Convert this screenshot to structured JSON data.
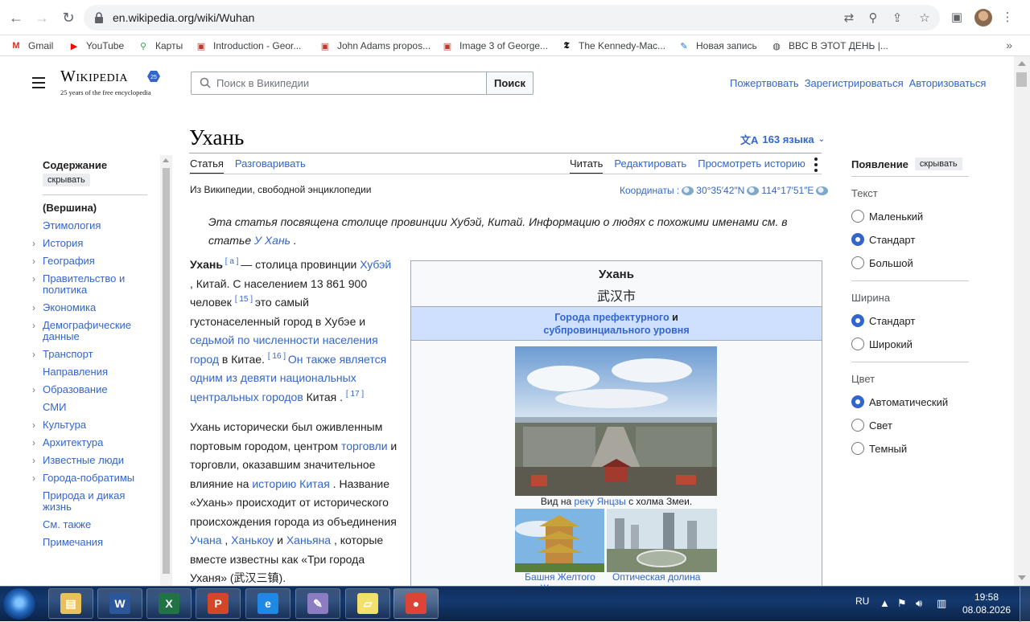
{
  "browser": {
    "url": "en.wikipedia.org/wiki/Wuhan",
    "bookmarks": [
      {
        "label": "Gmail",
        "icon": "gmail-icon",
        "color": "#d93025"
      },
      {
        "label": "YouTube",
        "icon": "youtube-icon",
        "color": "#ff0000"
      },
      {
        "label": "Карты",
        "icon": "maps-pin-icon",
        "color": "#34a853"
      },
      {
        "label": "Introduction - Geor...",
        "icon": "loc-icon",
        "color": "#c0392b"
      },
      {
        "label": "John Adams propos...",
        "icon": "loc-icon",
        "color": "#c0392b"
      },
      {
        "label": "Image 3 of George...",
        "icon": "loc-icon",
        "color": "#c0392b"
      },
      {
        "label": "The Kennedy-Mac...",
        "icon": "nyt-icon",
        "color": "#000000"
      },
      {
        "label": "Новая запись",
        "icon": "blog-icon",
        "color": "#1a73e8"
      },
      {
        "label": "BBC В ЭТОТ ДЕНЬ |...",
        "icon": "globe-icon",
        "color": "#3c4043"
      }
    ],
    "more": "»"
  },
  "wiki": {
    "logo_title": "Wikipedia",
    "logo_sub": "25 years of the free encyclopedia",
    "search_placeholder": "Поиск в Википедии",
    "search_button": "Поиск",
    "user_links": [
      "Пожертвовать",
      "Зарегистрироваться",
      "Авторизоваться"
    ],
    "title": "Ухань",
    "languages": "163 языка",
    "tabs_left": [
      "Статья",
      "Разговаривать"
    ],
    "tabs_right": [
      "Читать",
      "Редактировать",
      "Просмотреть историю"
    ],
    "from_wiki": "Из Википедии, свободной энциклопедии",
    "coords_label": "Координаты :",
    "coords_lat": "30°35′42″N",
    "coords_lon": "114°17′51″E",
    "hatnote_text": "Эта статья посвящена столице провинции Хубэй, Китай. Информацию о людях с похожими именами см. в статье",
    "hatnote_link": "У Хань",
    "hatnote_end": "."
  },
  "toc": {
    "heading": "Содержание",
    "hide": "скрывать",
    "items": [
      {
        "label": "(Вершина)",
        "bold": true,
        "chevron": false
      },
      {
        "label": "Этимология",
        "chevron": false
      },
      {
        "label": "История",
        "chevron": true
      },
      {
        "label": "География",
        "chevron": true
      },
      {
        "label": "Правительство и политика",
        "chevron": true
      },
      {
        "label": "Экономика",
        "chevron": true
      },
      {
        "label": "Демографические данные",
        "chevron": true
      },
      {
        "label": "Транспорт",
        "chevron": true
      },
      {
        "label": "Направления",
        "chevron": false
      },
      {
        "label": "Образование",
        "chevron": true
      },
      {
        "label": "СМИ",
        "chevron": false
      },
      {
        "label": "Культура",
        "chevron": true
      },
      {
        "label": "Архитектура",
        "chevron": true
      },
      {
        "label": "Известные люди",
        "chevron": true
      },
      {
        "label": "Города-побратимы",
        "chevron": true
      },
      {
        "label": "Природа и дикая жизнь",
        "chevron": false
      },
      {
        "label": "См. также",
        "chevron": false
      },
      {
        "label": "Примечания",
        "chevron": false
      }
    ]
  },
  "article": {
    "p1": [
      {
        "t": "b",
        "v": "Ухань"
      },
      {
        "t": "sup",
        "v": " [ а ] "
      },
      {
        "t": "s",
        "v": " — столица провинции "
      },
      {
        "t": "a",
        "v": "Хубэй"
      },
      {
        "t": "s",
        "v": " , Китай. С населением 13 861 900 человек "
      },
      {
        "t": "sup",
        "v": " [ 15 ] "
      },
      {
        "t": "s",
        "v": " это самый густонаселенный город в Хубэе и "
      },
      {
        "t": "a",
        "v": "седьмой по численности населения город"
      },
      {
        "t": "s",
        "v": " в Китае. "
      },
      {
        "t": "sup",
        "v": " [ 16 ] "
      },
      {
        "t": "a",
        "v": " Он также является одним из девяти национальных центральных городов"
      },
      {
        "t": "s",
        "v": " Китая . "
      },
      {
        "t": "sup",
        "v": " [ 17 ] "
      }
    ],
    "p2": [
      {
        "t": "s",
        "v": "Ухань исторически был оживленным портовым городом, центром "
      },
      {
        "t": "a",
        "v": "торговли"
      },
      {
        "t": "s",
        "v": " и торговли, оказавшим значительное влияние на "
      },
      {
        "t": "a",
        "v": "историю Китая"
      },
      {
        "t": "s",
        "v": " . Название «Ухань» происходит от исторического происхождения города из объединения "
      },
      {
        "t": "a",
        "v": "Учана"
      },
      {
        "t": "s",
        "v": " , "
      },
      {
        "t": "a",
        "v": "Ханькоу"
      },
      {
        "t": "s",
        "v": " и "
      },
      {
        "t": "a",
        "v": "Ханьяна"
      },
      {
        "t": "s",
        "v": " , которые вместе известны как «Три города Уханя» (武汉三镇)."
      }
    ]
  },
  "infobox": {
    "title": "Ухань",
    "native": "武汉市",
    "type_link1": "Города префектурного",
    "type_and": " и ",
    "type_link2": "субпровинциального уровня",
    "caption_pre": "Вид на ",
    "caption_link": "реку Янцзы",
    "caption_post": " с холма Змеи.",
    "cap2": "Башня Желтого Журавля",
    "cap3": "Оптическая долина"
  },
  "appearance": {
    "heading": "Появление",
    "hide": "скрывать",
    "text_label": "Текст",
    "text_options": [
      {
        "label": "Маленький",
        "on": false
      },
      {
        "label": "Стандарт",
        "on": true
      },
      {
        "label": "Большой",
        "on": false
      }
    ],
    "width_label": "Ширина",
    "width_options": [
      {
        "label": "Стандарт",
        "on": true
      },
      {
        "label": "Широкий",
        "on": false
      }
    ],
    "color_label": "Цвет",
    "color_options": [
      {
        "label": "Автоматический",
        "on": true
      },
      {
        "label": "Свет",
        "on": false
      },
      {
        "label": "Темный",
        "on": false
      }
    ]
  },
  "taskbar": {
    "apps": [
      {
        "name": "explorer-taskbar-icon",
        "glyph": "▤",
        "bg": "#e8c15a"
      },
      {
        "name": "word-taskbar-icon",
        "glyph": "W",
        "bg": "#2b579a"
      },
      {
        "name": "excel-taskbar-icon",
        "glyph": "X",
        "bg": "#217346"
      },
      {
        "name": "powerpoint-taskbar-icon",
        "glyph": "P",
        "bg": "#d24726"
      },
      {
        "name": "ie-taskbar-icon",
        "glyph": "e",
        "bg": "#1e88e5"
      },
      {
        "name": "paint-taskbar-icon",
        "glyph": "✎",
        "bg": "#8e7cc3"
      },
      {
        "name": "sticky-notes-taskbar-icon",
        "glyph": "▱",
        "bg": "#f2e06b"
      },
      {
        "name": "chrome-taskbar-icon",
        "glyph": "●",
        "bg": "#db4437"
      }
    ],
    "lang": "RU",
    "time": "19:58",
    "date": "08.08.2026"
  }
}
